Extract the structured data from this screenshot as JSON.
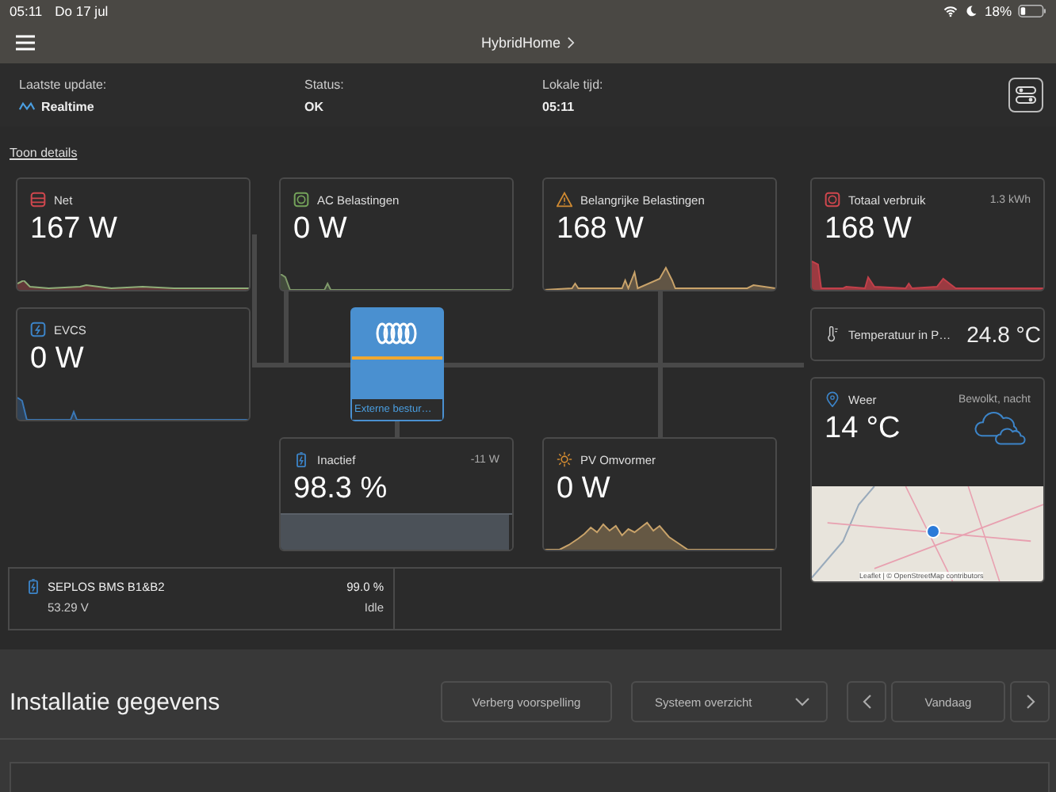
{
  "status_bar": {
    "time": "05:11",
    "date": "Do 17 jul",
    "battery": "18%"
  },
  "nav": {
    "title": "HybridHome"
  },
  "summary": [
    {
      "label": "Laatste update:",
      "value": "Realtime",
      "kind": "live"
    },
    {
      "label": "Status:",
      "value": "OK",
      "kind": "plain"
    },
    {
      "label": "Lokale tijd:",
      "value": "05:11",
      "kind": "plain"
    }
  ],
  "details_link": "Toon details",
  "flow_cards": [
    {
      "kind": "grid",
      "title": "Net",
      "value": "167 W"
    },
    {
      "kind": "ac",
      "title": "AC Belastingen",
      "value": "0 W"
    },
    {
      "kind": "warning",
      "title": "Belangrijke Belastingen",
      "value": "168 W"
    },
    {
      "kind": "ev",
      "title": "EVCS",
      "value": "0 W"
    }
  ],
  "inverter": {
    "label": "Externe bestur…"
  },
  "battery": {
    "title": "Inactief",
    "power": "-11 W",
    "value": "98.3 %",
    "level": 0.983
  },
  "pv": {
    "title": "PV Omvormer",
    "value": "0 W"
  },
  "total": {
    "title": "Totaal verbruik",
    "energy": "1.3 kWh",
    "value": "168 W"
  },
  "temperature": {
    "title": "Temperatuur in P…",
    "value": "24.8 °C"
  },
  "weather": {
    "title": "Weer",
    "condition": "Bewolkt, nacht",
    "value": "14 °C",
    "map_attribution": "Leaflet | © OpenStreetMap contributors"
  },
  "bms": {
    "name": "SEPLOS BMS B1&B2",
    "voltage": "53.29 V",
    "soc": "99.0 %",
    "state": "Idle"
  },
  "bottom": {
    "title": "Installatie gegevens",
    "forecast_button": "Verberg voorspelling",
    "view_select": "Systeem overzicht",
    "date_button": "Vandaag"
  }
}
